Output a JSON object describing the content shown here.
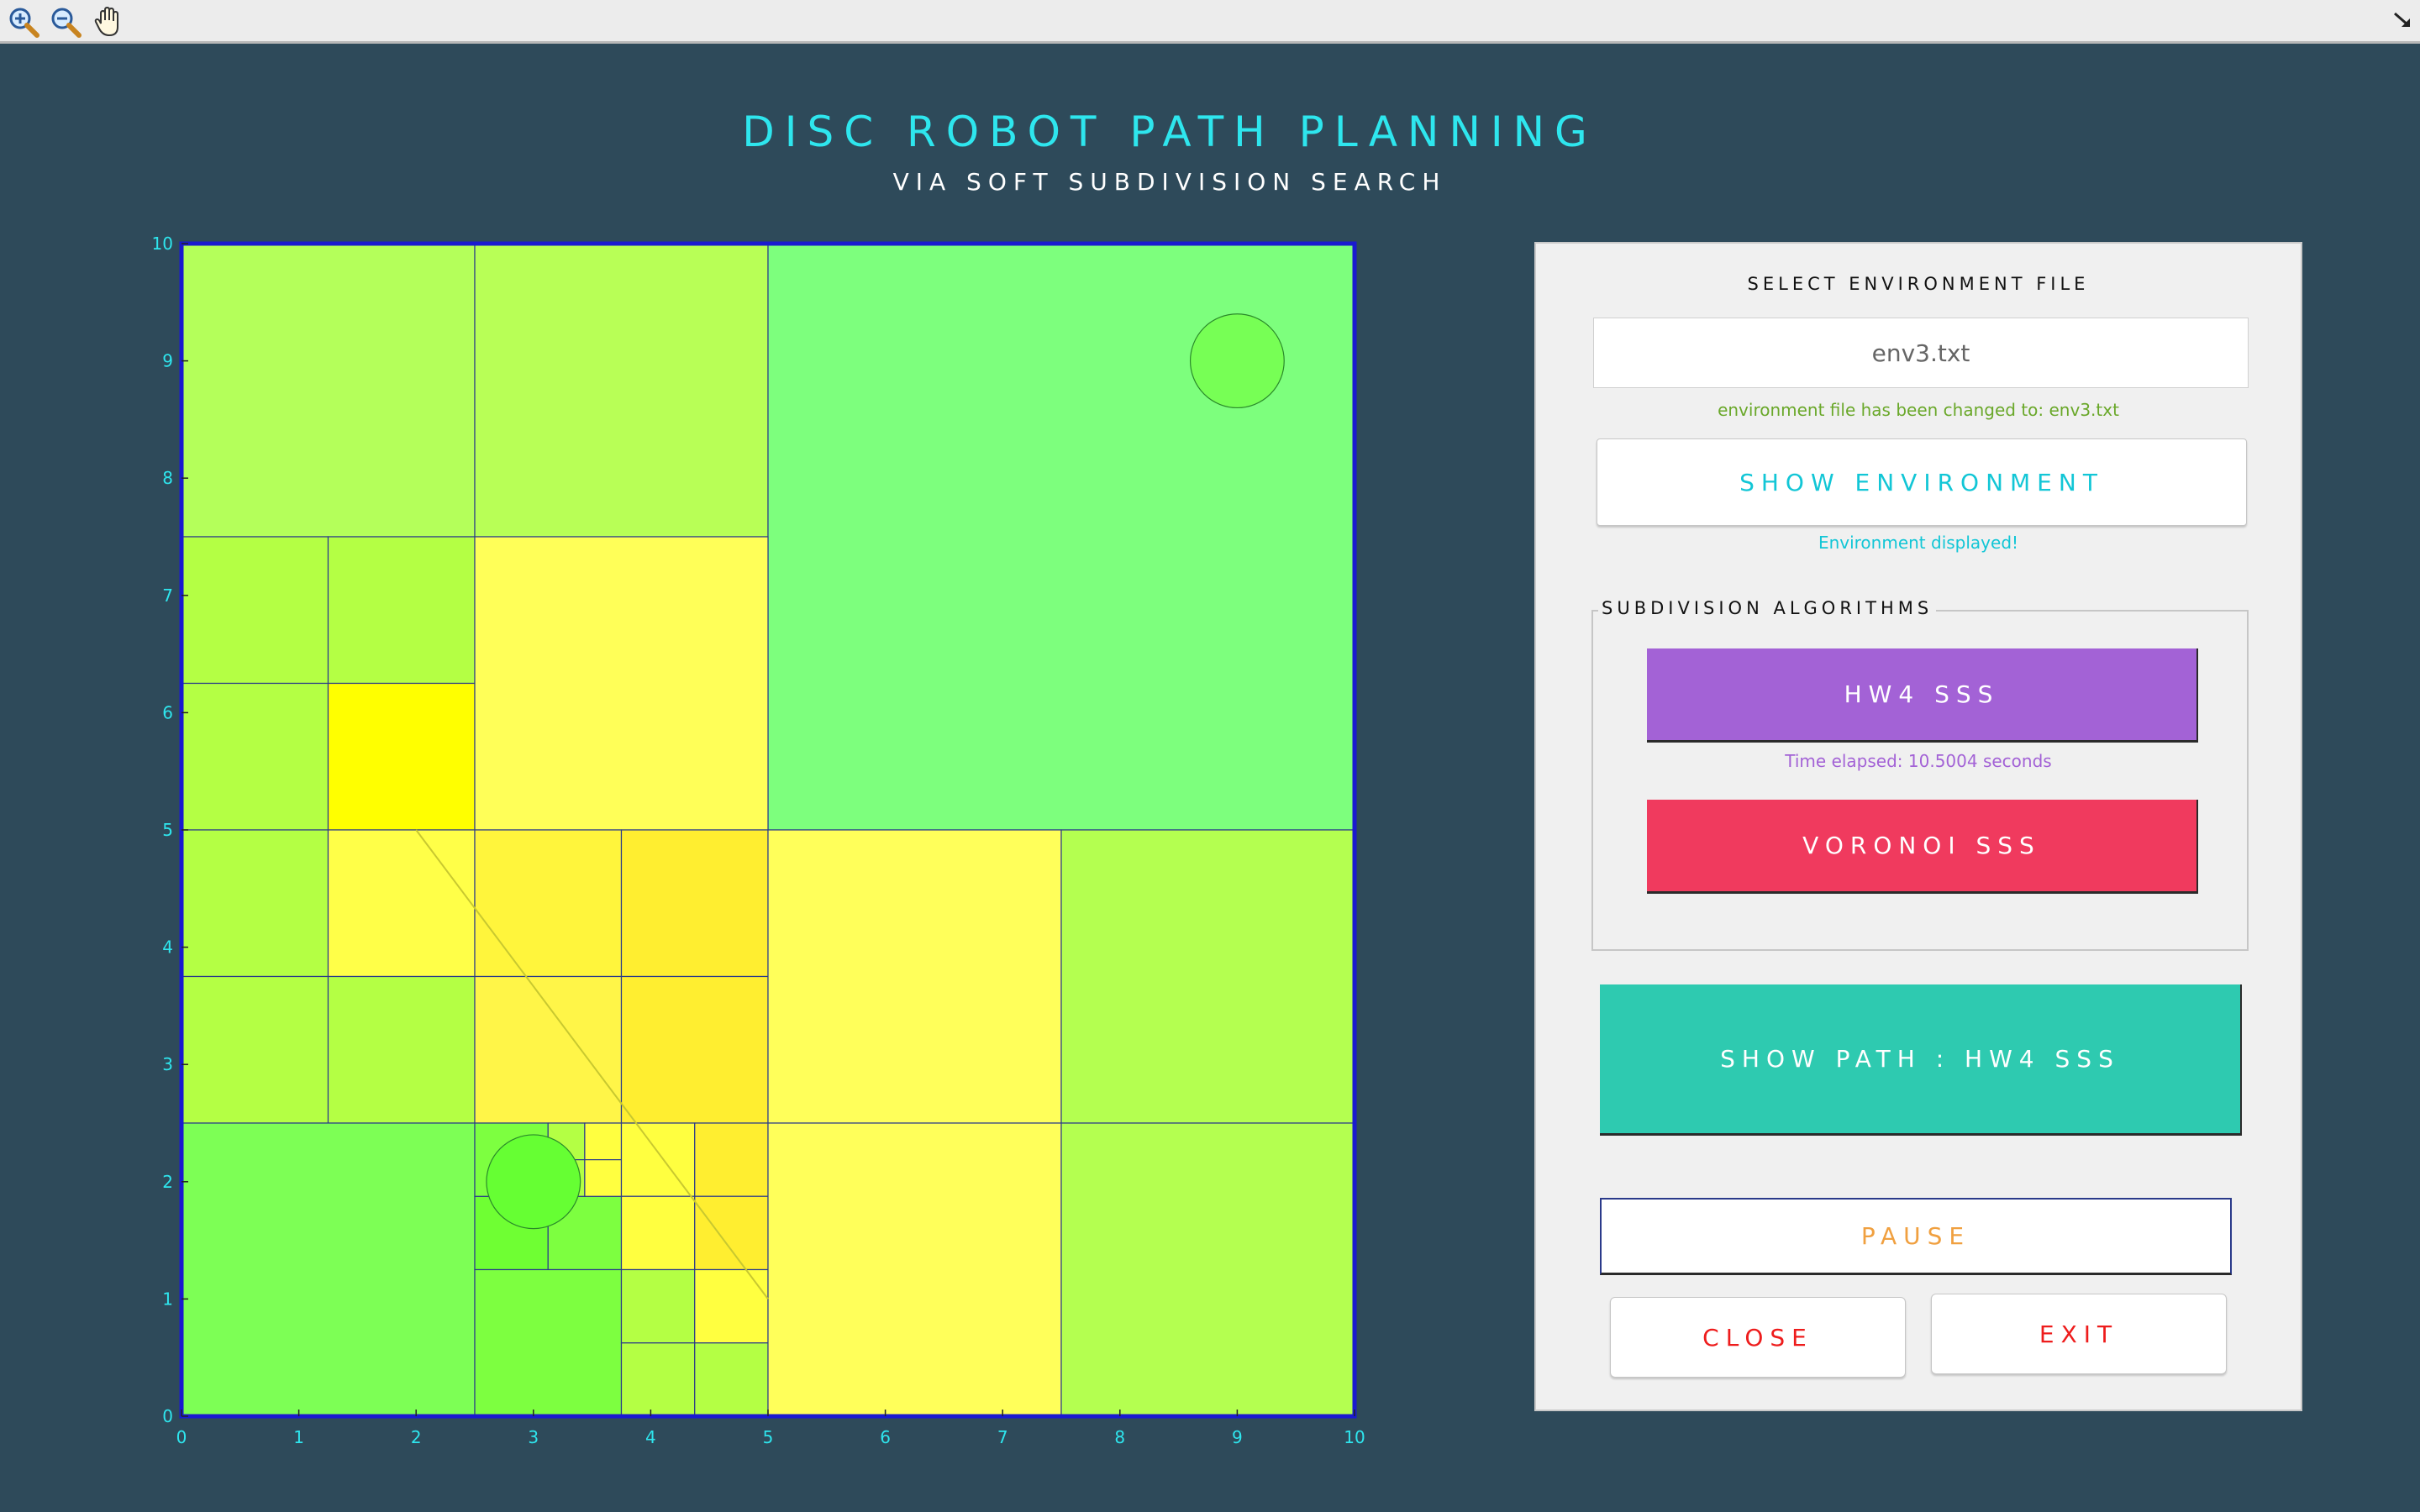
{
  "toolbar": {
    "buttons": [
      {
        "name": "zoom-in-icon"
      },
      {
        "name": "zoom-out-icon"
      },
      {
        "name": "pan-hand-icon"
      }
    ]
  },
  "header": {
    "title": "DISC ROBOT PATH PLANNING",
    "subtitle": "VIA SOFT SUBDIVISION SEARCH"
  },
  "plot": {
    "xlim": [
      0,
      10
    ],
    "ylim": [
      0,
      10
    ],
    "x_ticks": [
      "0",
      "1",
      "2",
      "3",
      "4",
      "5",
      "6",
      "7",
      "8",
      "9",
      "10"
    ],
    "y_ticks": [
      "0",
      "1",
      "2",
      "3",
      "4",
      "5",
      "6",
      "7",
      "8",
      "9",
      "10"
    ],
    "colors": {
      "tick": "#2ee6ee",
      "frame": "#1a1ad0",
      "cell_border": "#2a3a8a"
    },
    "cells": [
      {
        "x": 0,
        "y": 7.5,
        "w": 2.5,
        "h": 2.5,
        "color": "#b4ff5a"
      },
      {
        "x": 2.5,
        "y": 7.5,
        "w": 2.5,
        "h": 2.5,
        "color": "#b8ff56"
      },
      {
        "x": 5,
        "y": 5,
        "w": 5,
        "h": 5,
        "color": "#7dff7d"
      },
      {
        "x": 0,
        "y": 6.25,
        "w": 1.25,
        "h": 1.25,
        "color": "#b4ff44"
      },
      {
        "x": 1.25,
        "y": 6.25,
        "w": 1.25,
        "h": 1.25,
        "color": "#b4ff44"
      },
      {
        "x": 0,
        "y": 5,
        "w": 1.25,
        "h": 1.25,
        "color": "#b4ff44"
      },
      {
        "x": 1.25,
        "y": 5,
        "w": 1.25,
        "h": 1.25,
        "color": "#ffff00"
      },
      {
        "x": 2.5,
        "y": 5,
        "w": 2.5,
        "h": 2.5,
        "color": "#ffff58"
      },
      {
        "x": 0,
        "y": 3.75,
        "w": 1.25,
        "h": 1.25,
        "color": "#b4ff44"
      },
      {
        "x": 1.25,
        "y": 3.75,
        "w": 1.25,
        "h": 1.25,
        "color": "#ffff48"
      },
      {
        "x": 0,
        "y": 2.5,
        "w": 1.25,
        "h": 1.25,
        "color": "#b4ff44"
      },
      {
        "x": 1.25,
        "y": 2.5,
        "w": 1.25,
        "h": 1.25,
        "color": "#b4ff44"
      },
      {
        "x": 2.5,
        "y": 3.75,
        "w": 1.25,
        "h": 1.25,
        "color": "#fff53c"
      },
      {
        "x": 3.75,
        "y": 3.75,
        "w": 1.25,
        "h": 1.25,
        "color": "#ffee30"
      },
      {
        "x": 2.5,
        "y": 2.5,
        "w": 1.25,
        "h": 1.25,
        "color": "#fff548"
      },
      {
        "x": 3.75,
        "y": 2.5,
        "w": 1.25,
        "h": 1.25,
        "color": "#ffee30"
      },
      {
        "x": 5,
        "y": 2.5,
        "w": 2.5,
        "h": 2.5,
        "color": "#ffff5a"
      },
      {
        "x": 7.5,
        "y": 2.5,
        "w": 2.5,
        "h": 2.5,
        "color": "#b4ff50"
      },
      {
        "x": 0,
        "y": 0,
        "w": 2.5,
        "h": 2.5,
        "color": "#7dff55"
      },
      {
        "x": 2.5,
        "y": 1.25,
        "w": 0.625,
        "h": 0.625,
        "color": "#6fff33"
      },
      {
        "x": 3.125,
        "y": 1.25,
        "w": 0.625,
        "h": 0.625,
        "color": "#7dff40"
      },
      {
        "x": 2.5,
        "y": 1.875,
        "w": 0.625,
        "h": 0.625,
        "color": "#7dff40"
      },
      {
        "x": 3.125,
        "y": 2.1875,
        "w": 0.3125,
        "h": 0.3125,
        "color": "#b4ff44"
      },
      {
        "x": 3.4375,
        "y": 2.1875,
        "w": 0.3125,
        "h": 0.3125,
        "color": "#ffff40"
      },
      {
        "x": 3.125,
        "y": 1.875,
        "w": 0.3125,
        "h": 0.3125,
        "color": "#b4ff44"
      },
      {
        "x": 3.4375,
        "y": 1.875,
        "w": 0.3125,
        "h": 0.3125,
        "color": "#ffff40"
      },
      {
        "x": 3.75,
        "y": 1.875,
        "w": 0.625,
        "h": 0.625,
        "color": "#ffff40"
      },
      {
        "x": 4.375,
        "y": 1.875,
        "w": 0.625,
        "h": 0.625,
        "color": "#ffee30"
      },
      {
        "x": 3.75,
        "y": 1.25,
        "w": 0.625,
        "h": 0.625,
        "color": "#ffff40"
      },
      {
        "x": 4.375,
        "y": 1.25,
        "w": 0.625,
        "h": 0.625,
        "color": "#ffee30"
      },
      {
        "x": 2.5,
        "y": 0,
        "w": 1.25,
        "h": 1.25,
        "color": "#7dff40"
      },
      {
        "x": 3.75,
        "y": 0.625,
        "w": 0.625,
        "h": 0.625,
        "color": "#b4ff44"
      },
      {
        "x": 4.375,
        "y": 0.625,
        "w": 0.625,
        "h": 0.625,
        "color": "#ffff40"
      },
      {
        "x": 3.75,
        "y": 0,
        "w": 0.625,
        "h": 0.625,
        "color": "#b4ff44"
      },
      {
        "x": 4.375,
        "y": 0,
        "w": 0.625,
        "h": 0.625,
        "color": "#b4ff44"
      },
      {
        "x": 5,
        "y": 0,
        "w": 2.5,
        "h": 2.5,
        "color": "#ffff5a"
      },
      {
        "x": 7.5,
        "y": 0,
        "w": 2.5,
        "h": 2.5,
        "color": "#b4ff50"
      }
    ],
    "discs": [
      {
        "cx": 9,
        "cy": 9,
        "r": 0.4,
        "color": "#77ff55"
      },
      {
        "cx": 3,
        "cy": 2,
        "r": 0.4,
        "color": "#66ff33"
      }
    ],
    "obstacle_edge": {
      "x1": 2,
      "y1": 5,
      "x2": 5,
      "y2": 1
    }
  },
  "panel": {
    "select_label": "SELECT ENVIRONMENT FILE",
    "file_value": "env3.txt",
    "file_status": "environment file has been changed to: env3.txt",
    "show_env_label": "SHOW ENVIRONMENT",
    "env_status": "Environment displayed!",
    "group_label": "SUBDIVISION ALGORITHMS",
    "hw4_label": "HW4 SSS",
    "time_status": "Time elapsed: 10.5004 seconds",
    "voronoi_label": "VORONOI SSS",
    "show_path_label": "SHOW PATH : HW4 SSS",
    "pause_label": "PAUSE",
    "close_label": "CLOSE",
    "exit_label": "EXIT"
  }
}
